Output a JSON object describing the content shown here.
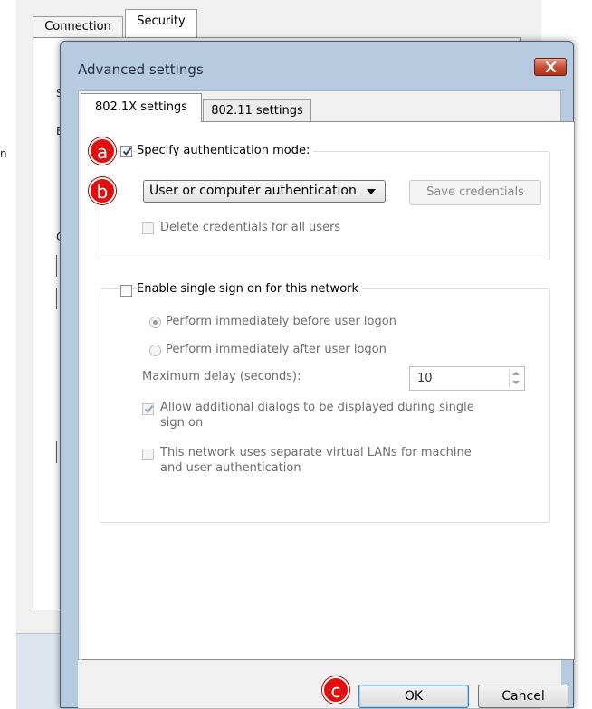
{
  "background_window": {
    "tabs": [
      "Connection",
      "Security"
    ],
    "partial_letters": [
      "S",
      "E",
      "n",
      "C"
    ]
  },
  "dialog": {
    "title": "Advanced settings",
    "close_icon": "close-x-icon",
    "tabs": [
      {
        "label": "802.1X settings",
        "selected": true
      },
      {
        "label": "802.11 settings",
        "selected": false
      }
    ],
    "auth": {
      "specify_mode_label": "Specify authentication mode:",
      "specify_mode_checked": true,
      "mode_value": "User or computer authentication",
      "save_credentials_label": "Save credentials",
      "delete_credentials_label": "Delete credentials for all users"
    },
    "sso": {
      "enable_label": "Enable single sign on for this network",
      "enable_checked": false,
      "radio_before_label": "Perform immediately before user logon",
      "radio_after_label": "Perform immediately after user logon",
      "max_delay_label": "Maximum delay (seconds):",
      "max_delay_value": "10",
      "allow_dialogs_label_1": "Allow additional dialogs to be displayed during single",
      "allow_dialogs_label_2": "sign on",
      "separate_vlan_label_1": "This network uses separate virtual LANs for machine",
      "separate_vlan_label_2": "and user authentication"
    },
    "buttons": {
      "ok": "OK",
      "cancel": "Cancel"
    }
  },
  "annotations": {
    "a": "a",
    "b": "b",
    "c": "c",
    "color": "#e01010"
  }
}
